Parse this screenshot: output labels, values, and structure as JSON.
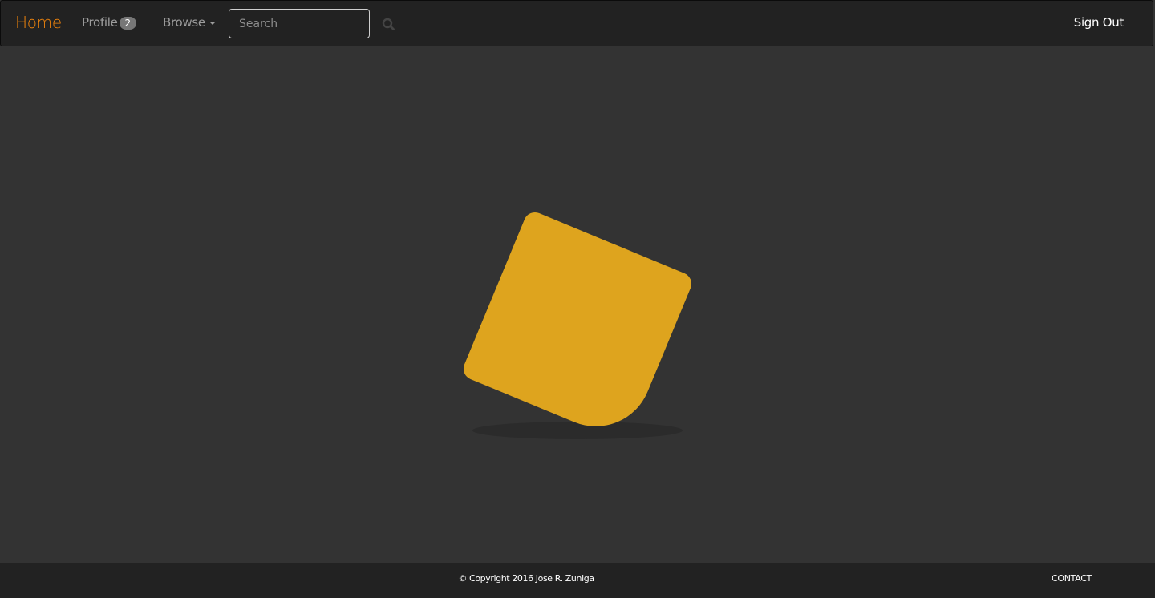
{
  "navbar": {
    "brand": "Home",
    "profile_label": "Profile",
    "profile_badge": "2",
    "browse_label": "Browse",
    "search_placeholder": "Search",
    "search_icon": "search-icon",
    "signout_label": "Sign Out"
  },
  "loader": {
    "color": "#dea41e",
    "shape": "rounded-square"
  },
  "footer": {
    "copyright": "© Copyright 2016 Jose R. Zuniga",
    "contact_label": "CONTACT"
  },
  "colors": {
    "accent": "#f0840c",
    "navbar_bg": "#222222",
    "page_bg": "#333333"
  }
}
